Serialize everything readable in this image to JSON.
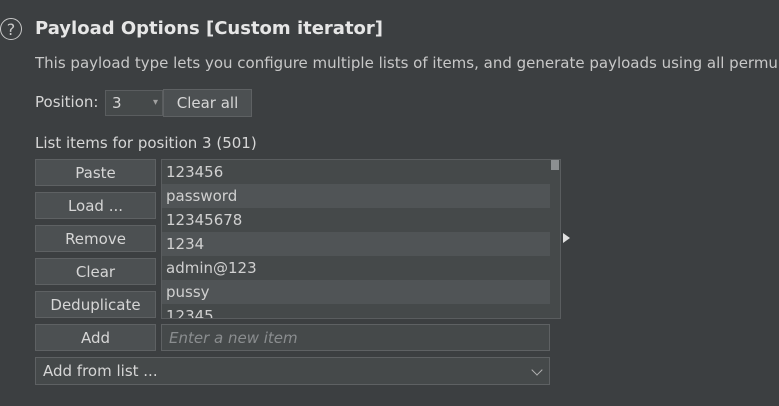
{
  "header": {
    "title": "Payload Options [Custom iterator]",
    "description": "This payload type lets you configure multiple lists of items, and generate payloads using all permu"
  },
  "position": {
    "label": "Position:",
    "value": "3",
    "clear_all_label": "Clear all"
  },
  "list": {
    "label": "List items for position 3 (501)",
    "items": [
      "123456",
      "password",
      "12345678",
      "1234",
      "admin@123",
      "pussy",
      "12345"
    ]
  },
  "buttons": {
    "paste": "Paste",
    "load": "Load ...",
    "remove": "Remove",
    "clear": "Clear",
    "deduplicate": "Deduplicate",
    "add": "Add"
  },
  "new_item": {
    "placeholder": "Enter a new item"
  },
  "add_from_list": {
    "label": "Add from list ..."
  },
  "icons": {
    "help": "help-icon",
    "arrow": "right-arrow-icon",
    "dropdown": "chevron-down-icon"
  }
}
